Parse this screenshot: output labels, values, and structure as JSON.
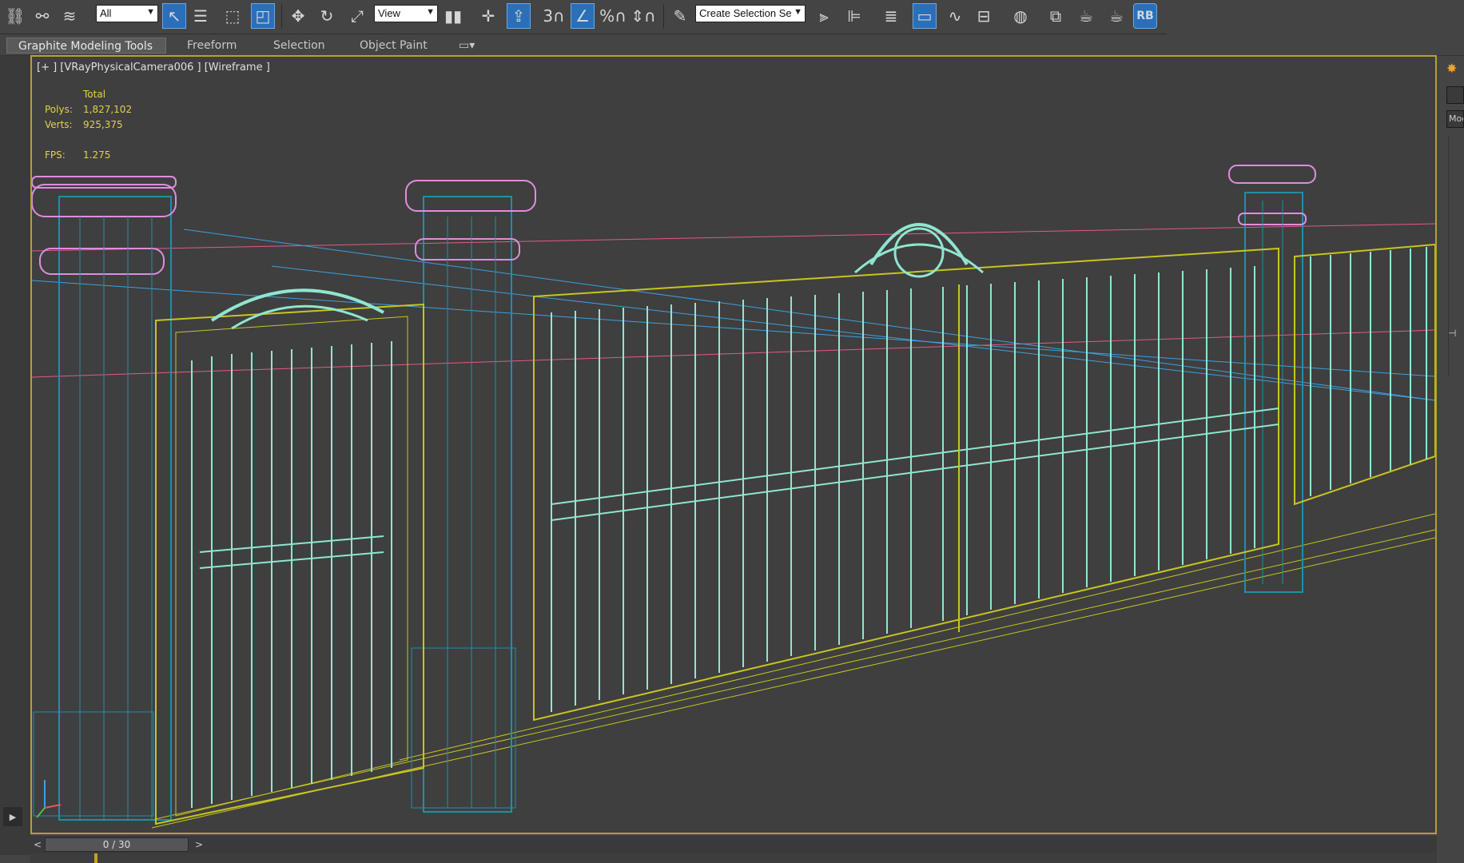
{
  "toolbar": {
    "selection_filter": "All",
    "reference_coord": "View",
    "named_selection_placeholder": "Create Selection Se",
    "snap_label": "3",
    "percent_snap_label": "%",
    "rb_label": "RB",
    "icons": [
      "link-icon",
      "unlink-icon",
      "bind-spacewarp-icon",
      "select-object-icon",
      "select-by-name-icon",
      "rect-region-icon",
      "window-crossing-icon",
      "move-icon",
      "rotate-icon",
      "scale-icon",
      "use-pivot-icon",
      "select-manipulate-icon",
      "keyboard-shortcut-icon",
      "snap-toggle-icon",
      "angle-snap-icon",
      "percent-snap-icon",
      "spinner-snap-icon",
      "edit-named-sets-icon",
      "mirror-icon",
      "align-icon",
      "layer-manager-icon",
      "ribbon-toggle-icon",
      "curve-editor-icon",
      "schematic-view-icon",
      "material-editor-icon",
      "render-setup-icon",
      "rendered-frame-icon",
      "render-icon",
      "render-iterative-icon"
    ]
  },
  "ribbon": {
    "tabs": [
      "Graphite Modeling Tools",
      "Freeform",
      "Selection",
      "Object Paint"
    ],
    "active_tab": "Graphite Modeling Tools"
  },
  "viewport": {
    "label": "[+ ] [VRayPhysicalCamera006 ] [Wireframe ]",
    "stats_header": "Total",
    "polys_label": "Polys:",
    "polys_value": "1,827,102",
    "verts_label": "Verts:",
    "verts_value": "925,375",
    "fps_label": "FPS:",
    "fps_value": "1.275",
    "border_color": "#b8a12a",
    "wire_colors": {
      "gate": "#8fe6d0",
      "column": "#1f8fa8",
      "frame": "#c8c420",
      "cap": "#e08ce0",
      "line_blue": "#3aa0e0",
      "line_pink": "#e05a8a"
    }
  },
  "right_panel": {
    "mode_text": "Moc"
  },
  "timeline": {
    "prev": "<",
    "next": ">",
    "frame_text": "0 / 30"
  }
}
